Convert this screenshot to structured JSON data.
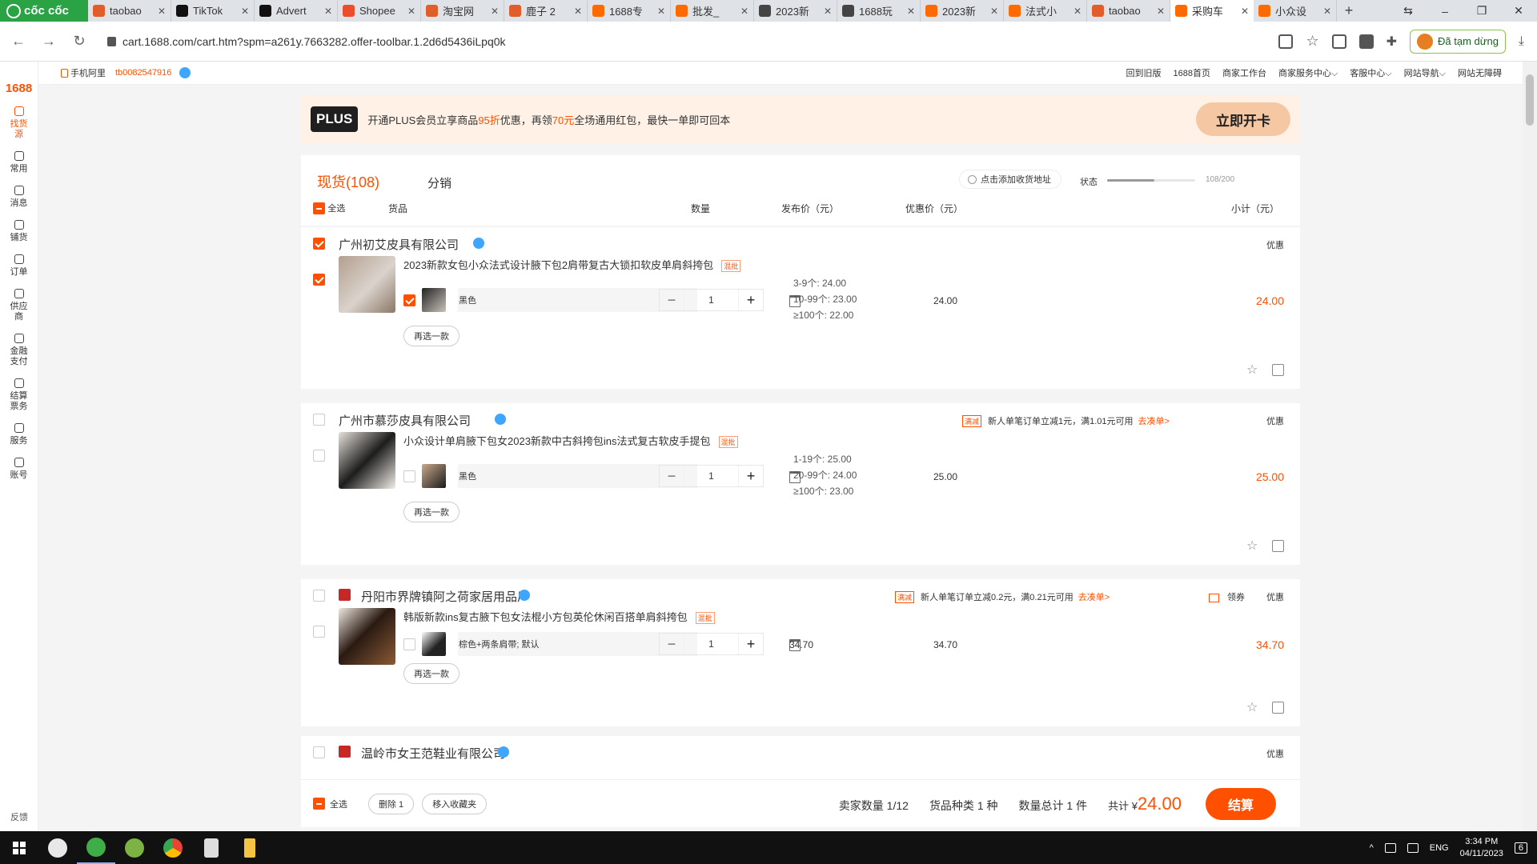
{
  "browser": {
    "brand": "cốc cốc",
    "tabs": [
      {
        "title": "taobao",
        "color": "#e35d2a"
      },
      {
        "title": "TikTok",
        "color": "#111111"
      },
      {
        "title": "Advert",
        "color": "#111111"
      },
      {
        "title": "Shopee",
        "color": "#ee4d2d"
      },
      {
        "title": "淘宝网",
        "color": "#e35d2a"
      },
      {
        "title": "鹿子 2",
        "color": "#e35d2a"
      },
      {
        "title": "1688专",
        "color": "#ff6a00"
      },
      {
        "title": "批发_",
        "color": "#ff6a00"
      },
      {
        "title": "2023新",
        "color": "#444444"
      },
      {
        "title": "1688玩",
        "color": "#444444"
      },
      {
        "title": "2023新",
        "color": "#ff6a00"
      },
      {
        "title": "法式小",
        "color": "#ff6a00"
      },
      {
        "title": "taobao",
        "color": "#e35d2a"
      },
      {
        "title": "采购车",
        "color": "#ff6a00",
        "active": true
      },
      {
        "title": "小众设",
        "color": "#ff6a00"
      }
    ],
    "new_tab": "+",
    "url": "cart.1688.com/cart.htm?spm=a261y.7663282.offer-toolbar.1.2d6d5436iLpq0k",
    "paused_label": "Đã tạm dừng"
  },
  "sidebar": {
    "logo": "1688",
    "items": [
      {
        "label": "找货源",
        "active": true
      },
      {
        "label": "常用"
      },
      {
        "label": "消息"
      },
      {
        "label": "铺货"
      },
      {
        "label": "订单"
      },
      {
        "label": "供应商"
      },
      {
        "label": "金融支付"
      },
      {
        "label": "结算票务"
      },
      {
        "label": "服务"
      },
      {
        "label": "账号"
      }
    ],
    "feedback": "反馈"
  },
  "topbar": {
    "mobile": "手机阿里",
    "user": "tb0082547916",
    "links": [
      "回到旧版",
      "1688首页",
      "商家工作台",
      "商家服务中心⌵",
      "客服中心⌵",
      "网站导航⌵",
      "网站无障碍"
    ]
  },
  "plus": {
    "badge": "PLUS",
    "text_a": "开通PLUS会员立享商品",
    "hl1": "95折",
    "text_b": "优惠，再领",
    "hl2": "70元",
    "text_c": "全场通用红包，最快一单即可回本",
    "button": "立即开卡"
  },
  "cart": {
    "tab_now": "现货(108)",
    "tab_dist": "分销",
    "add_address": "点击添加收货地址",
    "status_label": "状态",
    "capacity_used": 108,
    "capacity_total": 200,
    "capacity_text": "108/200",
    "columns": {
      "select_all": "全选",
      "goods": "货品",
      "qty": "数量",
      "price": "发布价（元）",
      "discount": "优惠价（元）",
      "subtotal": "小计（元）"
    },
    "groups": [
      {
        "shop": "广州初艾皮具有限公司",
        "deal": "优惠",
        "title": "2023新款女包小众法式设计腋下包2肩带复古大锁扣软皮单肩斜挎包",
        "mix": "混批",
        "sku": "黑色",
        "qty": "1",
        "tiers": [
          "3-9个: 24.00",
          "10-99个: 23.00",
          "≥100个: 22.00"
        ],
        "discount": "24.00",
        "subtotal": "24.00",
        "reselect": "再选一款",
        "checked": true
      },
      {
        "shop": "广州市慕莎皮具有限公司",
        "promo_tag": "满减",
        "promo": "新人单笔订单立减1元，满1.01元可用",
        "promo_go": "去凑单>",
        "deal": "优惠",
        "title": "小众设计单肩腋下包女2023新款中古斜挎包ins法式复古软皮手提包",
        "mix": "混批",
        "sku": "黑色",
        "qty": "1",
        "tiers": [
          "1-19个: 25.00",
          "20-99个: 24.00",
          "≥100个: 23.00"
        ],
        "discount": "25.00",
        "subtotal": "25.00",
        "reselect": "再选一款"
      },
      {
        "shop": "丹阳市界牌镇阿之荷家居用品厂",
        "promo_tag": "满减",
        "promo": "新人单笔订单立减0.2元，满0.21元可用",
        "promo_go": "去凑单>",
        "coupon": "领券",
        "deal": "优惠",
        "title": "韩版新款ins复古腋下包女法棍小方包英伦休闲百搭单肩斜挎包",
        "mix": "混批",
        "sku": "棕色+两条肩带; 默认",
        "qty": "1",
        "price": "34.70",
        "discount": "34.70",
        "subtotal": "34.70",
        "reselect": "再选一款"
      },
      {
        "shop": "温岭市女王范鞋业有限公司",
        "deal": "优惠"
      }
    ],
    "footer": {
      "select_all": "全选",
      "delete": "删除 1",
      "move_fav": "移入收藏夹",
      "sellers": "卖家数量 1/12",
      "kinds": "货品种类 1 种",
      "count": "数量总计 1 件",
      "total_label": "共计 ¥",
      "total": "24.00",
      "checkout": "结算"
    }
  },
  "taskbar": {
    "lang": "ENG",
    "time": "3:34 PM",
    "date": "04/11/2023",
    "notif": "6"
  }
}
